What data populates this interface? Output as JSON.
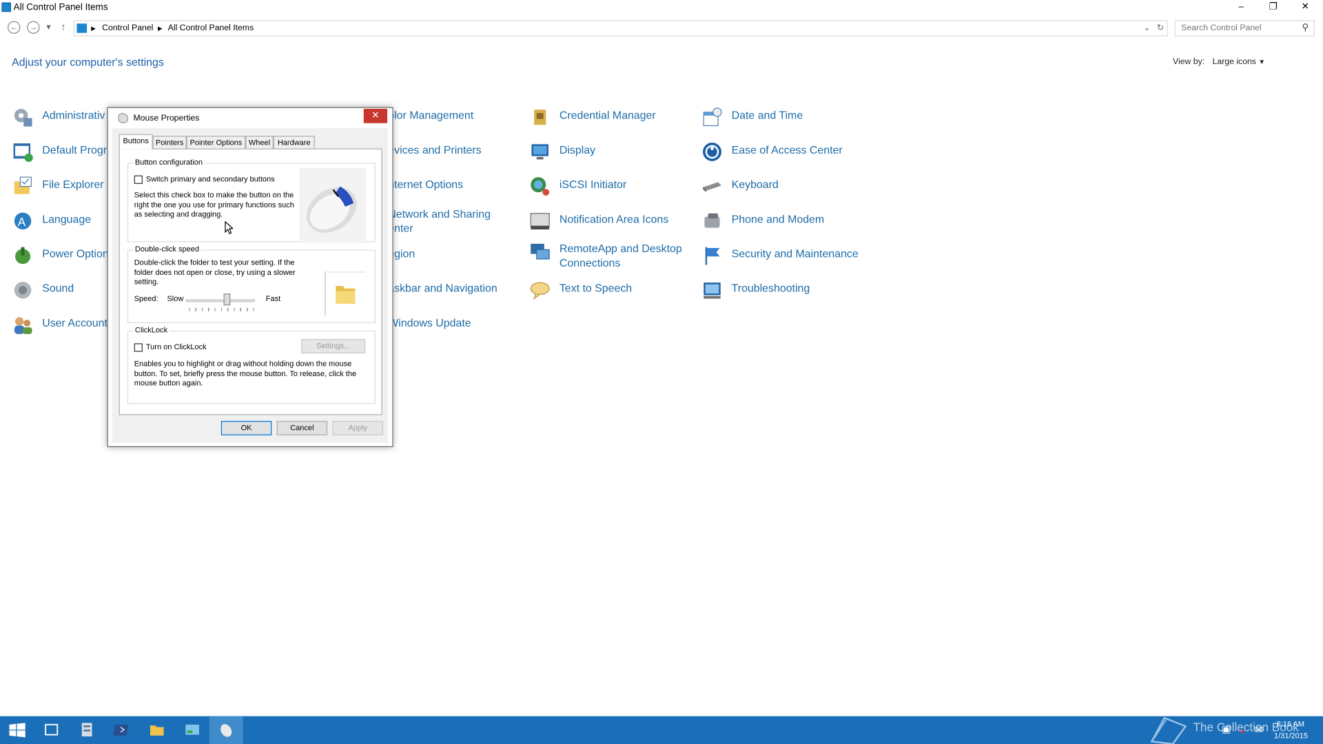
{
  "window": {
    "title": "All Control Panel Items",
    "controls": {
      "minimize": "–",
      "maximize": "❐",
      "close": "✕"
    }
  },
  "address": {
    "segments": [
      "Control Panel",
      "All Control Panel Items"
    ],
    "search_placeholder": "Search Control Panel"
  },
  "main": {
    "heading": "Adjust your computer's settings",
    "viewby_label": "View by:",
    "viewby_value": "Large icons"
  },
  "items": {
    "col1": [
      "Administrativ",
      "Default Progr",
      "File Explorer O",
      "Language",
      "Power Option",
      "Sound",
      "User Account"
    ],
    "col2": [
      "olor Management",
      "evices and Printers",
      "nternet Options",
      "Network and Sharing",
      "enter",
      "egion",
      "askbar and Navigation",
      "Windows Update"
    ],
    "col3": [
      "Credential Manager",
      "Display",
      "iSCSI Initiator",
      "Notification Area Icons",
      "RemoteApp and Desktop",
      "Connections",
      "Text to Speech"
    ],
    "col4": [
      "Date and Time",
      "Ease of Access Center",
      "Keyboard",
      "Phone and Modem",
      "Security and Maintenance",
      "Troubleshooting"
    ]
  },
  "dialog": {
    "title": "Mouse Properties",
    "tabs": [
      "Buttons",
      "Pointers",
      "Pointer Options",
      "Wheel",
      "Hardware"
    ],
    "button_config": {
      "label": "Button configuration",
      "checkbox": "Switch primary and secondary buttons",
      "desc": [
        "Select this check box to make the button on the",
        "right the one you use for primary functions such",
        "as selecting and dragging."
      ]
    },
    "dblclick": {
      "label": "Double-click speed",
      "desc": [
        "Double-click the folder to test your setting. If the",
        "folder does not open or close, try using a slower",
        "setting."
      ],
      "speed_label": "Speed:",
      "slow": "Slow",
      "fast": "Fast",
      "speed_fraction": 0.6
    },
    "clicklock": {
      "label": "ClickLock",
      "checkbox": "Turn on ClickLock",
      "settings_button": "Settings...",
      "desc": [
        "Enables you to highlight or drag without holding down the mouse",
        "button. To set, briefly press the mouse button. To release, click the",
        "mouse button again."
      ]
    },
    "buttons": {
      "ok": "OK",
      "cancel": "Cancel",
      "apply": "Apply"
    }
  },
  "taskbar": {
    "watermark": "The Collection Book",
    "time": "8:16 AM",
    "date": "1/31/2015"
  },
  "colors": {
    "link": "#1e6ca8",
    "heading": "#1e5ea8",
    "taskbar": "#1b6fb8",
    "close_red": "#c7372f"
  }
}
